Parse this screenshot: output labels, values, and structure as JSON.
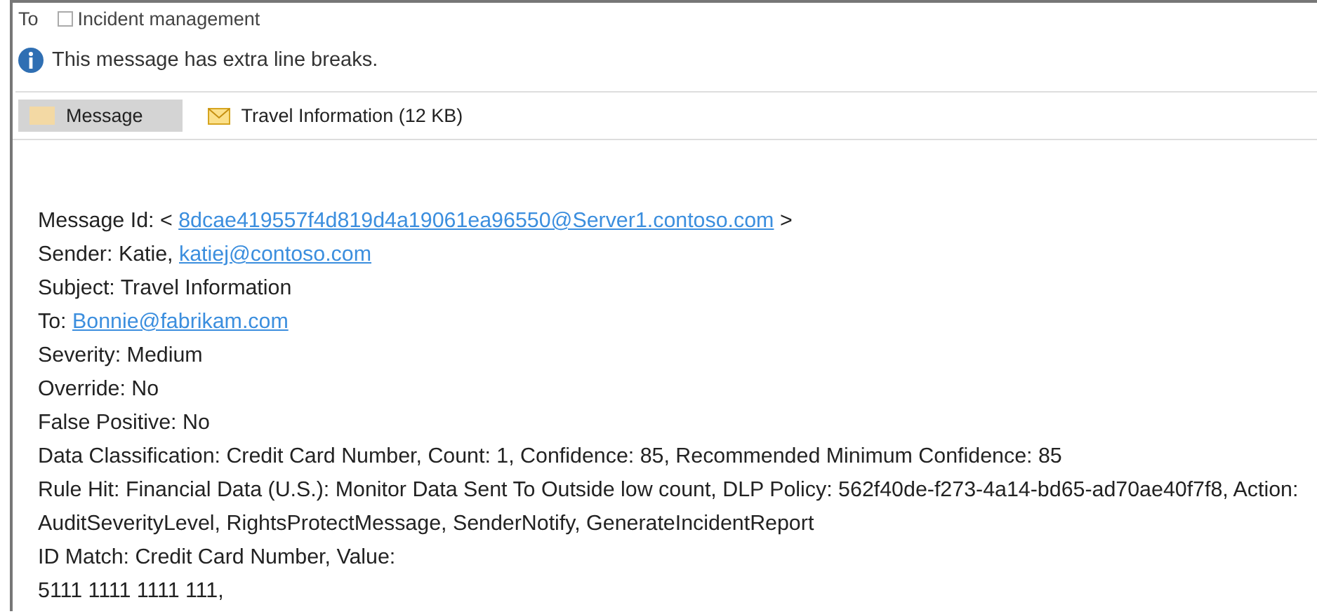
{
  "header": {
    "to_label": "To",
    "checkbox": {
      "label": "Incident management",
      "checked": false
    }
  },
  "info_bar": {
    "text": "This message has extra line breaks."
  },
  "tabs": [
    {
      "label": "Message",
      "kind": "message",
      "selected": true
    },
    {
      "label": "Travel Information (12 KB)",
      "kind": "attachment",
      "selected": false
    }
  ],
  "body": {
    "lines": [
      [
        {
          "kind": "label",
          "text": "Message Id:"
        },
        {
          "kind": "text",
          "text": "<"
        },
        {
          "kind": "link",
          "text": "8dcae419557f4d819d4a19061ea96550@Server1.contoso.com"
        },
        {
          "kind": "text",
          "text": ">"
        }
      ],
      [
        {
          "kind": "label",
          "text": "Sender:"
        },
        {
          "kind": "text",
          "text": "Katie,"
        },
        {
          "kind": "link",
          "text": "katiej@contoso.com"
        }
      ],
      [
        {
          "kind": "label",
          "text": "Subject: Travel Information"
        }
      ],
      [
        {
          "kind": "label",
          "text": "To:"
        },
        {
          "kind": "link",
          "text": "Bonnie@fabrikam.com"
        }
      ],
      [
        {
          "kind": "label",
          "text": "Severity: Medium"
        }
      ],
      [
        {
          "kind": "label",
          "text": "Override: No"
        }
      ],
      [
        {
          "kind": "label",
          "text": "False Positive: No"
        }
      ],
      [
        {
          "kind": "label",
          "text": "Data Classification: Credit Card Number, Count: 1, Confidence: 85, Recommended Minimum Confidence: 85"
        }
      ],
      [
        {
          "kind": "label",
          "text": "Rule Hit: Financial Data (U.S.): Monitor Data Sent To Outside low count, DLP Policy: 562f40de-f273-4a14-bd65-ad70ae40f7f8, Action: AuditSeverityLevel, RightsProtectMessage, SenderNotify, GenerateIncidentReport"
        }
      ],
      [
        {
          "kind": "label",
          "text": "ID Match: Credit Card Number, Value:"
        }
      ],
      [
        {
          "kind": "label",
          "text": "5111 1111 1111 111,"
        }
      ]
    ]
  }
}
